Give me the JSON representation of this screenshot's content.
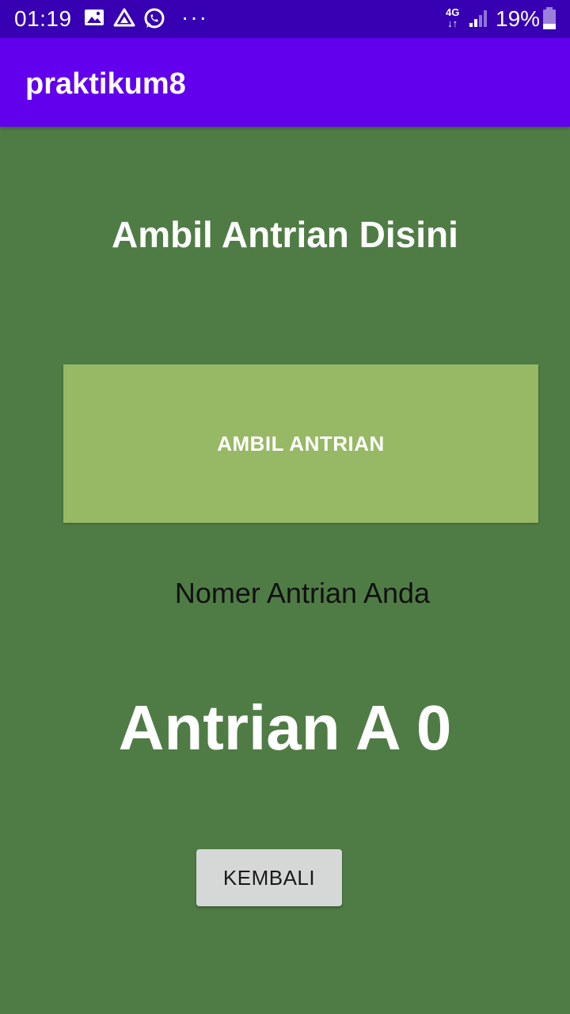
{
  "status_bar": {
    "time": "01:19",
    "icons": [
      "image-icon",
      "drive-icon",
      "whatsapp-icon"
    ],
    "more": "···",
    "network_top": "4G",
    "network_bottom": "↓↑",
    "battery_percent": "19%"
  },
  "app_bar": {
    "title": "praktikum8"
  },
  "main": {
    "heading": "Ambil Antrian Disini",
    "take_button_label": "AMBIL ANTRIAN",
    "queue_label": "Nomer Antrian Anda",
    "queue_number": "Antrian A 0",
    "back_button_label": "KEMBALI"
  },
  "colors": {
    "status_bar": "#3700b3",
    "app_bar": "#6200ee",
    "background": "#4f7c45",
    "take_button": "#97b865",
    "back_button": "#d6d7d7"
  }
}
